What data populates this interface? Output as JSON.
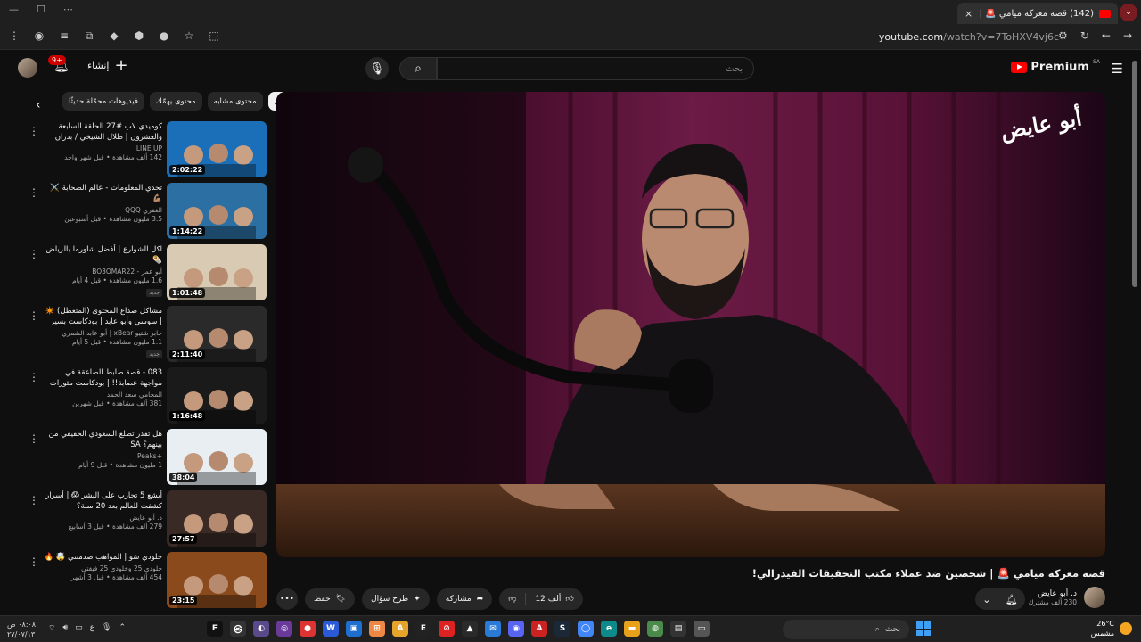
{
  "browser": {
    "tab_title": "(142) قصة معركة ميامي 🚨 | ...",
    "tab_close": "×",
    "new_tab": "+",
    "url_domain": "youtube.com",
    "url_path": "/watch?v=7ToHXV4vj6c",
    "window_controls": [
      "—",
      "☐",
      "⋯"
    ]
  },
  "header": {
    "create_label": "إنشاء",
    "notif_count": "9+",
    "search_placeholder": "بحث",
    "logo_word": "Premium",
    "region": "SA"
  },
  "chips": [
    {
      "label": "فيديوهات محمّلة حديثًا",
      "active": false
    },
    {
      "label": "محتوى يهمّك",
      "active": false
    },
    {
      "label": "محتوى مشابه",
      "active": false
    },
    {
      "label": "الكل",
      "active": true
    }
  ],
  "playlist": [
    {
      "title": "كوميدي لاب #27 الحلقة السابعة والعشرون | طلال الشيخي / بدران وسيف الحلقة ابرا...",
      "channel": "LINE UP",
      "meta": "142 ألف مشاهدة • قبل شهر واحد",
      "duration": "2:02:22",
      "thumb_text": "COMEDY LAB",
      "thumb_color": "#1b6fb8",
      "new": false
    },
    {
      "title": "تحدي المعلومات - عالم الصحابة ⚔️ 💪🏽",
      "channel": "الغفري QQQ",
      "meta": "3.5 مليون مشاهدة • قبل أسبوعين",
      "duration": "1:14:22",
      "thumb_text": "الصحابة",
      "thumb_color": "#2b6fa3",
      "new": false
    },
    {
      "title": "اكل الشوارع | أفضل شاورما بالرياض 🌯",
      "channel": "أبو عمر - BO3OMAR22",
      "meta": "1.6 مليون مشاهدة • قبل 4 أيام",
      "duration": "1:01:48",
      "thumb_text": "وش أفضل مطعم شاورما؟",
      "thumb_color": "#d9cbb3",
      "new": true
    },
    {
      "title": "مشاكل صداع المحتوى (المتعطل) ✴️ | سوسي وأبو عابد | بودكاست بسير خير",
      "channel": "جابر شتيو xBear | أبو عابد الشمري",
      "meta": "1.1 مليون مشاهدة • قبل 5 أيام",
      "duration": "2:11:40",
      "thumb_text": "بسير خير",
      "thumb_color": "#2a2a2a",
      "new": true
    },
    {
      "title": "083 - قصة ضابط الصاعقة في مواجهة عصابة!! | بودكاست مثورات قضائية",
      "channel": "المحامي سعد الحمد",
      "meta": "381 ألف مشاهدة • قبل شهرين",
      "duration": "1:16:48",
      "thumb_text": "ضابط الصاعقة",
      "thumb_color": "#1a1a1a",
      "new": false
    },
    {
      "title": "هل تقدر تطلع السعودي الحقيقي من بينهم؟ SA",
      "channel": "+Peaks",
      "meta": "1 مليون مشاهدة • قبل 9 أيام",
      "duration": "38:04",
      "thumb_text": "السعودي",
      "thumb_color": "#e8eef2",
      "new": false
    },
    {
      "title": "أبشع 5 تجارب على البشر 😱 | أسرار كشفت للعالم بعد 20 سنة؟",
      "channel": "د. أبو عايض",
      "meta": "279 ألف مشاهدة • قبل 3 أسابيع",
      "duration": "27:57",
      "thumb_text": "التحكم بالعقل",
      "thumb_color": "#3a2a26",
      "new": false
    },
    {
      "title": "خلودي شو | المواهب صدمتني 🤯 🔥",
      "channel": "خلودي 25 وخلودي 25 فيفتي",
      "meta": "454 ألف مشاهدة • قبل 3 أشهر",
      "duration": "23:15",
      "thumb_text": "مواهب خلودي",
      "thumb_color": "#8a4a1c",
      "new": false
    }
  ],
  "video": {
    "title": "قصة معركة ميامي 🚨 | شخصين ضد عملاء مكتب التحقيقات الفيدرالي!",
    "watermark": "أبو عايض",
    "channel_name": "د. أبو عايض",
    "channel_subs": "230 ألف مشترك",
    "likes": "12 ألف",
    "share_label": "مشاركة",
    "ask_label": "طرح سؤال",
    "save_label": "حفظ",
    "more_label": "•••"
  },
  "taskbar": {
    "time": "٠٨:٠٨ ص",
    "date": "٢٧/٠٧/١٣",
    "lang": "ع",
    "search_placeholder": "بحث",
    "temp": "26°C",
    "weather": "مشمس",
    "apps": [
      {
        "glyph": "F",
        "color": "#111"
      },
      {
        "glyph": "㉿",
        "color": "#333"
      },
      {
        "glyph": "◐",
        "color": "#5a4a8a"
      },
      {
        "glyph": "◎",
        "color": "#6a3a9a"
      },
      {
        "glyph": "●",
        "color": "#d33"
      },
      {
        "glyph": "W",
        "color": "#2a5ad8"
      },
      {
        "glyph": "▣",
        "color": "#1e6fd0"
      },
      {
        "glyph": "⊞",
        "color": "#e84"
      },
      {
        "glyph": "A",
        "color": "#e7a42b"
      },
      {
        "glyph": "E",
        "color": "#222"
      },
      {
        "glyph": "⊘",
        "color": "#d22"
      },
      {
        "glyph": "▲",
        "color": "#2a2a2a"
      },
      {
        "glyph": "✉",
        "color": "#2a7bd8"
      },
      {
        "glyph": "◉",
        "color": "#5865f2"
      },
      {
        "glyph": "A",
        "color": "#c22"
      },
      {
        "glyph": "S",
        "color": "#1b2838"
      },
      {
        "glyph": "◯",
        "color": "#4285f4"
      },
      {
        "glyph": "e",
        "color": "#0d8a8a"
      },
      {
        "glyph": "▬",
        "color": "#e8a11a"
      },
      {
        "glyph": "◍",
        "color": "#4a8a4a"
      },
      {
        "glyph": "▤",
        "color": "#333"
      },
      {
        "glyph": "▭",
        "color": "#555"
      }
    ]
  },
  "colors": {
    "brand_red": "#ff0000",
    "bg": "#0f0f0f",
    "chip_bg": "#272727"
  }
}
